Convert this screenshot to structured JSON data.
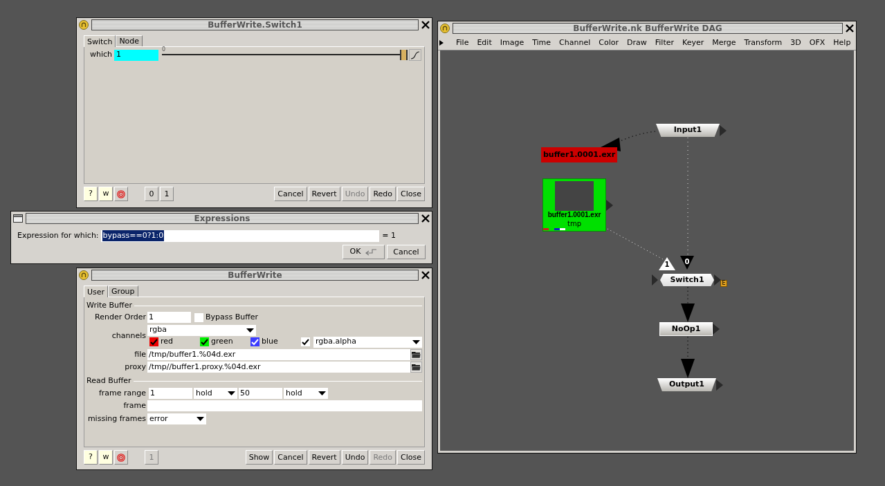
{
  "switch_panel": {
    "title": "BufferWrite.Switch1",
    "tabs": [
      {
        "label": "Switch",
        "selected": true
      },
      {
        "label": "Node",
        "selected": false
      }
    ],
    "knob": {
      "label": "which",
      "value": "1",
      "tick": "0",
      "level": 1
    },
    "toolbar": [
      {
        "kind": "help",
        "label": "?"
      },
      {
        "kind": "web",
        "label": "w"
      },
      {
        "kind": "target"
      }
    ],
    "view_buttons": [
      {
        "label": "0",
        "disabled": false
      },
      {
        "label": "1",
        "disabled": false
      }
    ],
    "buttons": [
      {
        "label": "Cancel",
        "disabled": false
      },
      {
        "label": "Revert",
        "disabled": false
      },
      {
        "label": "Undo",
        "disabled": true
      },
      {
        "label": "Redo",
        "disabled": false
      },
      {
        "label": "Close",
        "disabled": false
      }
    ]
  },
  "expressions": {
    "title": "Expressions",
    "label": "Expression for which:",
    "value": "bypass==0?1:0",
    "selected": true,
    "result": "= 1",
    "buttons": [
      {
        "kind": "ok",
        "label": "OK"
      },
      {
        "kind": "plain",
        "label": "Cancel"
      }
    ]
  },
  "bufferwrite_panel": {
    "title": "BufferWrite",
    "tabs": [
      {
        "label": "User",
        "selected": true
      },
      {
        "label": "Group",
        "selected": false
      }
    ],
    "write_section": "Write Buffer",
    "render_order": {
      "label": "Render Order",
      "value": "1"
    },
    "bypass": {
      "label": "Bypass Buffer",
      "checked": false
    },
    "channels": {
      "label": "channels",
      "value": "rgba",
      "toggles": [
        {
          "label": "red",
          "checked": true,
          "color": "#ee0000"
        },
        {
          "label": "green",
          "checked": true,
          "color": "#00ee00"
        },
        {
          "label": "blue",
          "checked": true,
          "color": "#3c3cff"
        }
      ],
      "alpha": {
        "checked": true,
        "value": "rgba.alpha"
      }
    },
    "file": {
      "label": "file",
      "value": "/tmp/buffer1.%04d.exr"
    },
    "proxy": {
      "label": "proxy",
      "value": "/tmp//buffer1.proxy.%04d.exr"
    },
    "read_section": "Read Buffer",
    "frame_range": {
      "label": "frame range",
      "first": "1",
      "first_mode": "hold",
      "last": "50",
      "last_mode": "hold"
    },
    "frame": {
      "label": "frame"
    },
    "missing_frames": {
      "label": "missing frames",
      "value": "error"
    },
    "toolbar": [
      {
        "kind": "help",
        "label": "?"
      },
      {
        "kind": "web",
        "label": "w"
      },
      {
        "kind": "target"
      }
    ],
    "view_buttons": [
      {
        "label": "1",
        "disabled": true
      }
    ],
    "buttons": [
      {
        "label": "Show",
        "disabled": false
      },
      {
        "label": "Cancel",
        "disabled": false
      },
      {
        "label": "Revert",
        "disabled": false
      },
      {
        "label": "Undo",
        "disabled": false
      },
      {
        "label": "Redo",
        "disabled": true
      },
      {
        "label": "Close",
        "disabled": false
      }
    ]
  },
  "dag": {
    "title": "BufferWrite.nk BufferWrite DAG",
    "menu": [
      "File",
      "Edit",
      "Image",
      "Time",
      "Channel",
      "Color",
      "Draw",
      "Filter",
      "Keyer",
      "Merge",
      "Transform",
      "3D",
      "OFX",
      "Help"
    ],
    "nodes": [
      {
        "kind": "input",
        "label": "Input1"
      },
      {
        "kind": "read",
        "label": "buffer1.0001.exr",
        "color": "#cc0000"
      },
      {
        "kind": "read_thumb",
        "label": "buffer1.0001.exr",
        "sublabel": "tmp",
        "color": "#00e000"
      },
      {
        "kind": "switch",
        "label": "Switch1",
        "badge": "E",
        "inputs": [
          {
            "kind": "light",
            "label": "1"
          },
          {
            "kind": "dark",
            "label": "0"
          }
        ]
      },
      {
        "kind": "noop",
        "label": "NoOp1"
      },
      {
        "kind": "output",
        "label": "Output1"
      }
    ]
  }
}
